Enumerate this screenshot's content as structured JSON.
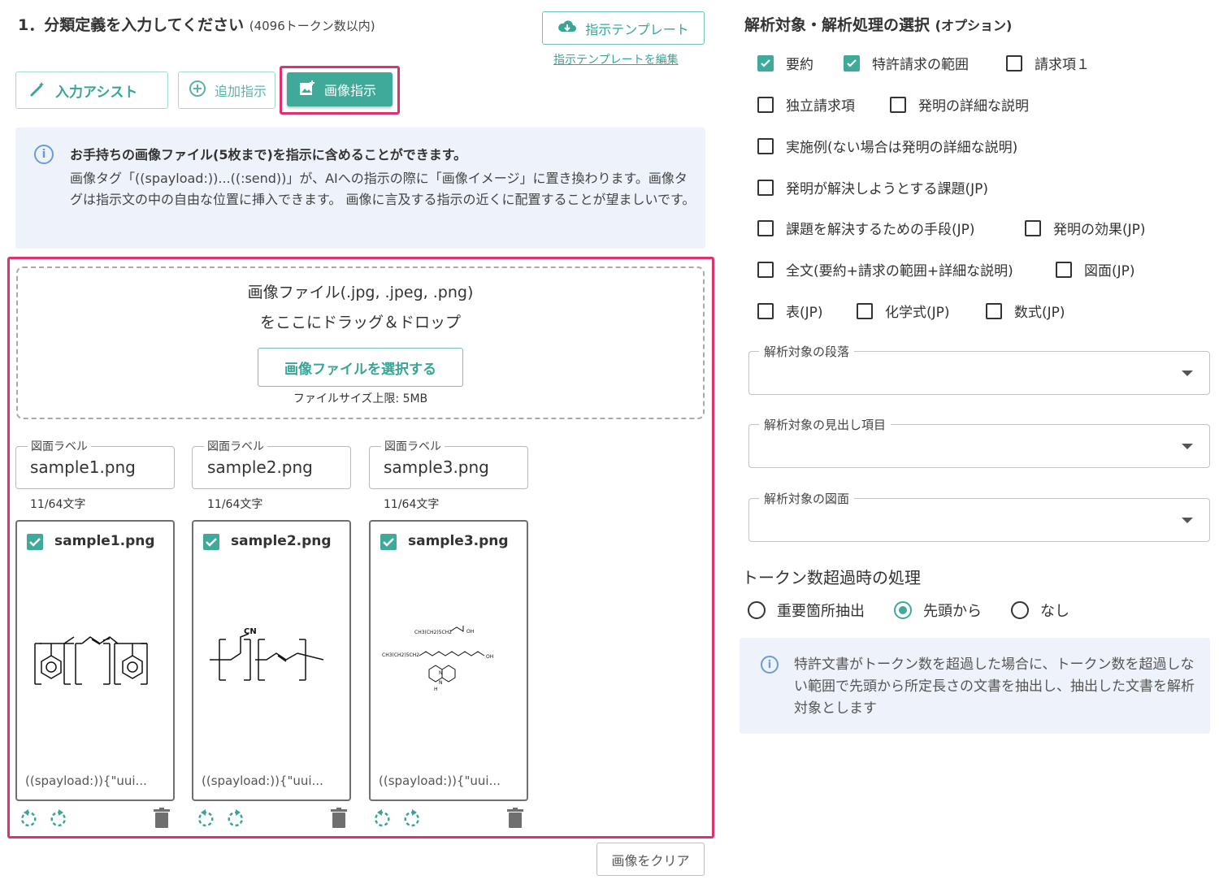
{
  "left": {
    "title": "1．分類定義を入力してください",
    "title_limit": "(4096トークン数以内)",
    "template_button": "指示テンプレート",
    "template_edit_link": "指示テンプレートを編集",
    "tools": {
      "assist": "入力アシスト",
      "add": "追加指示",
      "image": "画像指示"
    },
    "info": {
      "head": "お手持ちの画像ファイル(5枚まで)を指示に含めることができます。",
      "body": "画像タグ「((spayload:))...((:send))」が、AIへの指示の際に「画像イメージ」に置き換わります。画像タグは指示文の中の自由な位置に挿入できます。 画像に言及する指示の近くに配置することが望ましいです。"
    },
    "dropzone": {
      "line1": "画像ファイル(.jpg, .jpeg, .png)",
      "line2": "をここにドラッグ＆ドロップ",
      "select_button": "画像ファイルを選択する",
      "size_limit": "ファイルサイズ上限: 5MB"
    },
    "images": [
      {
        "field_label": "図面ラベル",
        "value": "sample1.png",
        "count": "11/64文字",
        "name": "sample1.png",
        "payload": "((spayload:)){\"uui...",
        "checked": true
      },
      {
        "field_label": "図面ラベル",
        "value": "sample2.png",
        "count": "11/64文字",
        "name": "sample2.png",
        "payload": "((spayload:)){\"uui...",
        "checked": true
      },
      {
        "field_label": "図面ラベル",
        "value": "sample3.png",
        "count": "11/64文字",
        "name": "sample3.png",
        "payload": "((spayload:)){\"uui...",
        "checked": true
      }
    ],
    "thumb3_labels": {
      "a": "CH3(CH2)5CH2",
      "b": "OH",
      "c": "CH3(CH2)5CH2",
      "d": "OH",
      "e": "N",
      "f": "N",
      "g": "H"
    },
    "thumb2_label": "CN",
    "clear_button": "画像をクリア"
  },
  "right": {
    "title": "解析対象・解析処理の選択",
    "title_opt": "(オプション)",
    "checkboxes": [
      {
        "label": "要約",
        "checked": true
      },
      {
        "label": "特許請求の範囲",
        "checked": true
      },
      {
        "label": "請求項１",
        "checked": false
      },
      {
        "label": "独立請求項",
        "checked": false
      },
      {
        "label": "発明の詳細な説明",
        "checked": false
      },
      {
        "label": "実施例(ない場合は発明の詳細な説明)",
        "checked": false
      },
      {
        "label": "発明が解決しようとする課題(JP)",
        "checked": false
      },
      {
        "label": "課題を解決するための手段(JP)",
        "checked": false
      },
      {
        "label": "発明の効果(JP)",
        "checked": false
      },
      {
        "label": "全文(要約+請求の範囲+詳細な説明)",
        "checked": false
      },
      {
        "label": "図面(JP)",
        "checked": false
      },
      {
        "label": "表(JP)",
        "checked": false
      },
      {
        "label": "化学式(JP)",
        "checked": false
      },
      {
        "label": "数式(JP)",
        "checked": false
      }
    ],
    "selects": [
      {
        "label": "解析対象の段落",
        "value": ""
      },
      {
        "label": "解析対象の見出し項目",
        "value": ""
      },
      {
        "label": "解析対象の図面",
        "value": ""
      }
    ],
    "token_title": "トークン数超過時の処理",
    "radios": [
      {
        "label": "重要箇所抽出",
        "selected": false
      },
      {
        "label": "先頭から",
        "selected": true
      },
      {
        "label": "なし",
        "selected": false
      }
    ],
    "token_info": "特許文書がトークン数を超過した場合に、トークン数を超過しない範囲で先頭から所定長さの文書を抽出し、抽出した文書を解析対象とします"
  },
  "colors": {
    "accent": "#3fa99a",
    "highlight": "#e0316f",
    "info_bg": "#eef3fb"
  }
}
